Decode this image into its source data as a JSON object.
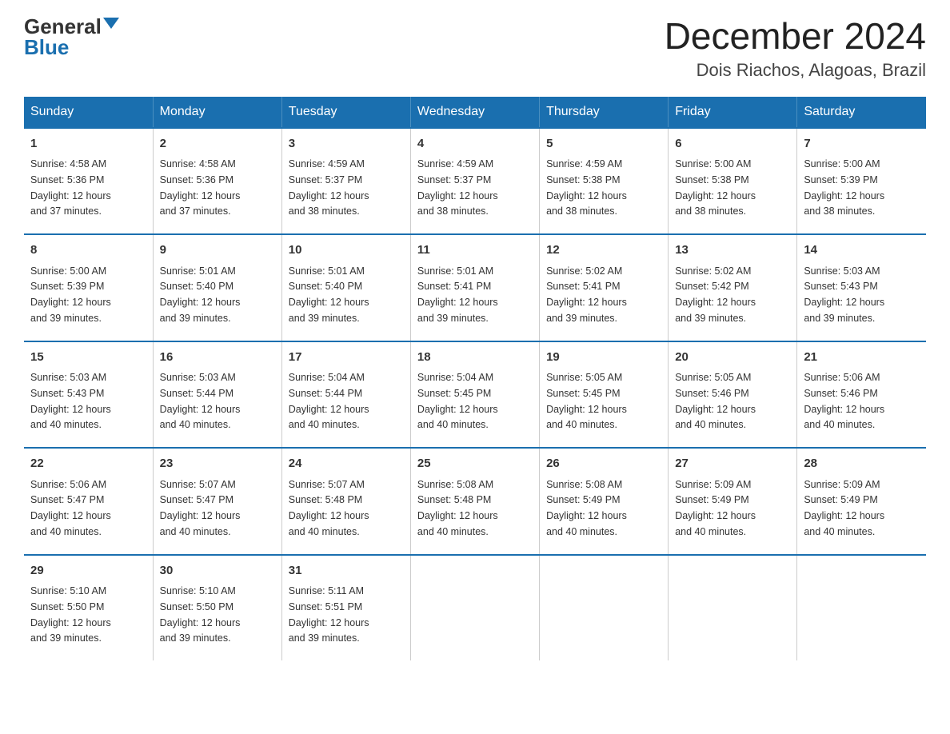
{
  "logo": {
    "general": "General",
    "blue": "Blue"
  },
  "title": "December 2024",
  "subtitle": "Dois Riachos, Alagoas, Brazil",
  "days_of_week": [
    "Sunday",
    "Monday",
    "Tuesday",
    "Wednesday",
    "Thursday",
    "Friday",
    "Saturday"
  ],
  "weeks": [
    [
      {
        "day": "1",
        "sunrise": "4:58 AM",
        "sunset": "5:36 PM",
        "daylight": "12 hours and 37 minutes."
      },
      {
        "day": "2",
        "sunrise": "4:58 AM",
        "sunset": "5:36 PM",
        "daylight": "12 hours and 37 minutes."
      },
      {
        "day": "3",
        "sunrise": "4:59 AM",
        "sunset": "5:37 PM",
        "daylight": "12 hours and 38 minutes."
      },
      {
        "day": "4",
        "sunrise": "4:59 AM",
        "sunset": "5:37 PM",
        "daylight": "12 hours and 38 minutes."
      },
      {
        "day": "5",
        "sunrise": "4:59 AM",
        "sunset": "5:38 PM",
        "daylight": "12 hours and 38 minutes."
      },
      {
        "day": "6",
        "sunrise": "5:00 AM",
        "sunset": "5:38 PM",
        "daylight": "12 hours and 38 minutes."
      },
      {
        "day": "7",
        "sunrise": "5:00 AM",
        "sunset": "5:39 PM",
        "daylight": "12 hours and 38 minutes."
      }
    ],
    [
      {
        "day": "8",
        "sunrise": "5:00 AM",
        "sunset": "5:39 PM",
        "daylight": "12 hours and 39 minutes."
      },
      {
        "day": "9",
        "sunrise": "5:01 AM",
        "sunset": "5:40 PM",
        "daylight": "12 hours and 39 minutes."
      },
      {
        "day": "10",
        "sunrise": "5:01 AM",
        "sunset": "5:40 PM",
        "daylight": "12 hours and 39 minutes."
      },
      {
        "day": "11",
        "sunrise": "5:01 AM",
        "sunset": "5:41 PM",
        "daylight": "12 hours and 39 minutes."
      },
      {
        "day": "12",
        "sunrise": "5:02 AM",
        "sunset": "5:41 PM",
        "daylight": "12 hours and 39 minutes."
      },
      {
        "day": "13",
        "sunrise": "5:02 AM",
        "sunset": "5:42 PM",
        "daylight": "12 hours and 39 minutes."
      },
      {
        "day": "14",
        "sunrise": "5:03 AM",
        "sunset": "5:43 PM",
        "daylight": "12 hours and 39 minutes."
      }
    ],
    [
      {
        "day": "15",
        "sunrise": "5:03 AM",
        "sunset": "5:43 PM",
        "daylight": "12 hours and 40 minutes."
      },
      {
        "day": "16",
        "sunrise": "5:03 AM",
        "sunset": "5:44 PM",
        "daylight": "12 hours and 40 minutes."
      },
      {
        "day": "17",
        "sunrise": "5:04 AM",
        "sunset": "5:44 PM",
        "daylight": "12 hours and 40 minutes."
      },
      {
        "day": "18",
        "sunrise": "5:04 AM",
        "sunset": "5:45 PM",
        "daylight": "12 hours and 40 minutes."
      },
      {
        "day": "19",
        "sunrise": "5:05 AM",
        "sunset": "5:45 PM",
        "daylight": "12 hours and 40 minutes."
      },
      {
        "day": "20",
        "sunrise": "5:05 AM",
        "sunset": "5:46 PM",
        "daylight": "12 hours and 40 minutes."
      },
      {
        "day": "21",
        "sunrise": "5:06 AM",
        "sunset": "5:46 PM",
        "daylight": "12 hours and 40 minutes."
      }
    ],
    [
      {
        "day": "22",
        "sunrise": "5:06 AM",
        "sunset": "5:47 PM",
        "daylight": "12 hours and 40 minutes."
      },
      {
        "day": "23",
        "sunrise": "5:07 AM",
        "sunset": "5:47 PM",
        "daylight": "12 hours and 40 minutes."
      },
      {
        "day": "24",
        "sunrise": "5:07 AM",
        "sunset": "5:48 PM",
        "daylight": "12 hours and 40 minutes."
      },
      {
        "day": "25",
        "sunrise": "5:08 AM",
        "sunset": "5:48 PM",
        "daylight": "12 hours and 40 minutes."
      },
      {
        "day": "26",
        "sunrise": "5:08 AM",
        "sunset": "5:49 PM",
        "daylight": "12 hours and 40 minutes."
      },
      {
        "day": "27",
        "sunrise": "5:09 AM",
        "sunset": "5:49 PM",
        "daylight": "12 hours and 40 minutes."
      },
      {
        "day": "28",
        "sunrise": "5:09 AM",
        "sunset": "5:49 PM",
        "daylight": "12 hours and 40 minutes."
      }
    ],
    [
      {
        "day": "29",
        "sunrise": "5:10 AM",
        "sunset": "5:50 PM",
        "daylight": "12 hours and 39 minutes."
      },
      {
        "day": "30",
        "sunrise": "5:10 AM",
        "sunset": "5:50 PM",
        "daylight": "12 hours and 39 minutes."
      },
      {
        "day": "31",
        "sunrise": "5:11 AM",
        "sunset": "5:51 PM",
        "daylight": "12 hours and 39 minutes."
      },
      null,
      null,
      null,
      null
    ]
  ],
  "labels": {
    "sunrise": "Sunrise:",
    "sunset": "Sunset:",
    "daylight": "Daylight:"
  }
}
